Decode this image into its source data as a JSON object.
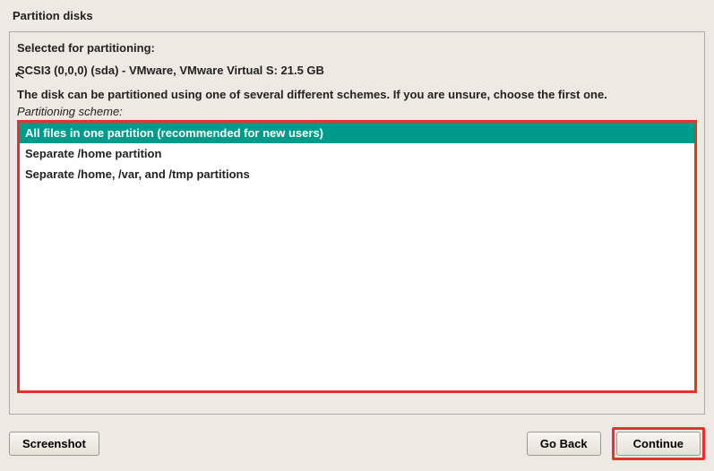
{
  "title": "Partition disks",
  "selected_label": "Selected for partitioning:",
  "disk_info": "SCSI3 (0,0,0) (sda) - VMware, VMware Virtual S: 21.5 GB",
  "instruction": "The disk can be partitioned using one of several different schemes. If you are unsure, choose the first one.",
  "scheme_label": "Partitioning scheme:",
  "options": [
    "All files in one partition (recommended for new users)",
    "Separate /home partition",
    "Separate /home, /var, and /tmp partitions"
  ],
  "buttons": {
    "screenshot": "Screenshot",
    "go_back": "Go Back",
    "continue": "Continue"
  }
}
